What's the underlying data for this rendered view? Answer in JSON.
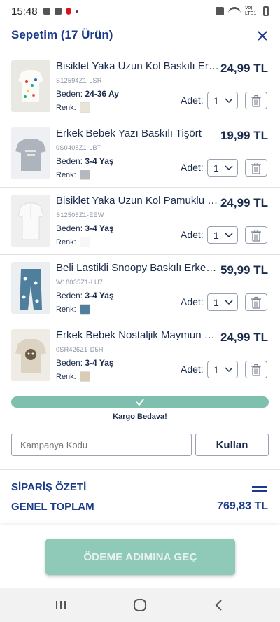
{
  "status_bar": {
    "time": "15:48",
    "network_label": "Vo) LTE1"
  },
  "header": {
    "title": "Sepetim (17 Ürün)"
  },
  "labels": {
    "size": "Beden:",
    "color": "Renk:",
    "qty": "Adet:"
  },
  "items": [
    {
      "name": "Bisiklet Yaka Uzun Kol Baskılı Erkek Bebek Sweatshirt",
      "price": "24,99 TL",
      "sku": "S12594Z1-LSR",
      "size": "24-36 Ay",
      "qty": "1",
      "swatch": "#e9e4d8"
    },
    {
      "name": "Erkek Bebek Yazı Baskılı Tişört",
      "price": "19,99 TL",
      "sku": "0S0408Z1-LBT",
      "size": "3-4 Yaş",
      "qty": "1",
      "swatch": "#b5b8bd"
    },
    {
      "name": "Bisiklet Yaka Uzun Kol Pamuklu Erkek Bebek Tişört",
      "price": "24,99 TL",
      "sku": "S12508Z1-EEW",
      "size": "3-4 Yaş",
      "qty": "1",
      "swatch": "#f7f7f5"
    },
    {
      "name": "Beli Lastikli Snoopy Baskılı Erkek Bebek Pijama Alt",
      "price": "59,99 TL",
      "sku": "W18035Z1-LU7",
      "size": "3-4 Yaş",
      "qty": "1",
      "swatch": "#4f7f9d"
    },
    {
      "name": "Erkek Bebek Nostaljik Maymun Baskılı Sweatshirt",
      "price": "24,99 TL",
      "sku": "0SR426Z1-D5H",
      "size": "3-4 Yaş",
      "qty": "1",
      "swatch": "#d8ccb6"
    }
  ],
  "shipping": {
    "text": "Kargo Bedava!"
  },
  "coupon": {
    "placeholder": "Kampanya Kodu",
    "apply_label": "Kullan"
  },
  "summary": {
    "title": "SİPARİŞ ÖZETİ",
    "total_label": "GENEL TOPLAM",
    "total_value": "769,83 TL"
  },
  "checkout": {
    "label": "ÖDEME ADIMINA GEÇ"
  },
  "colors": {
    "accent": "#1b3b8a",
    "text": "#1a2b4c",
    "button": "#8fc9b7",
    "shipping_bar": "#7ebfad"
  },
  "icons": {
    "close": "close-icon",
    "trash": "trash-icon",
    "chevron": "chevron-down-icon",
    "check": "check-icon",
    "menu": "menu-lines-icon"
  }
}
